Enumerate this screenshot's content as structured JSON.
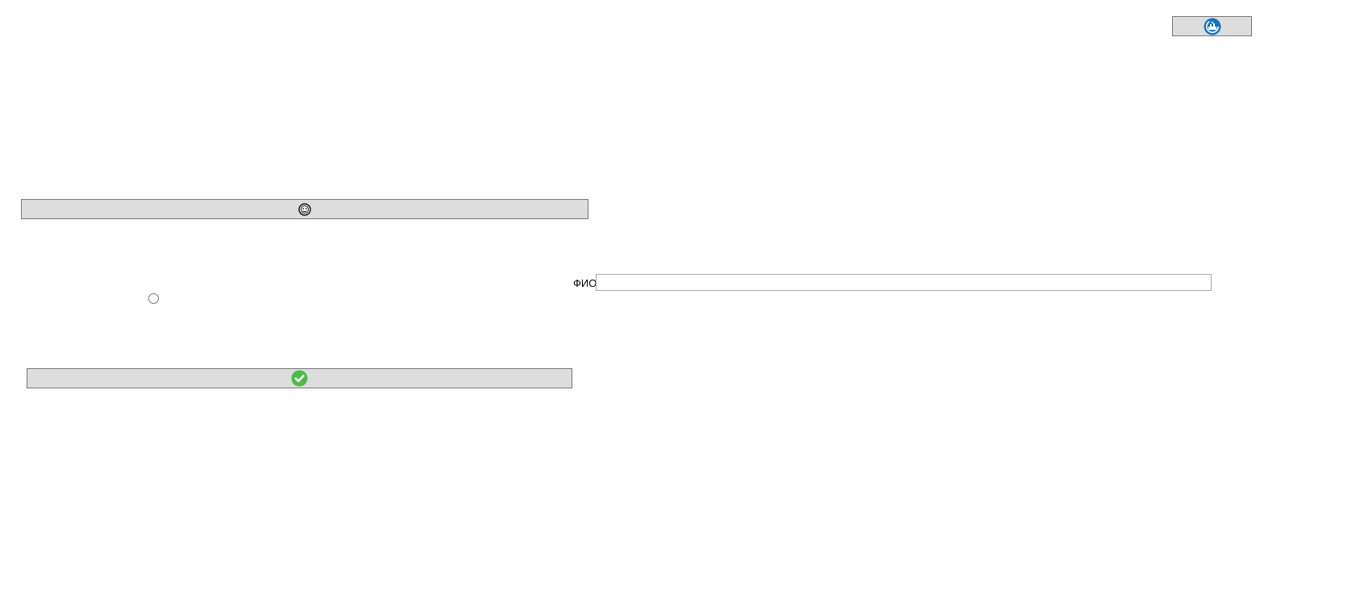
{
  "toolbar": {
    "top_button_icon": "blue-round-logo-icon",
    "wide_button_icon": "round-face-icon",
    "confirm_button_icon": "green-check-circle-icon"
  },
  "form": {
    "fio_label": "ФИО",
    "fio_value": "",
    "fio_placeholder": "",
    "radio_checked": false
  },
  "colors": {
    "button_bg": "#dddddd",
    "button_border": "#767676",
    "logo_blue": "#1572c4",
    "check_green": "#4cbb47",
    "input_border": "#a9a9a9"
  }
}
